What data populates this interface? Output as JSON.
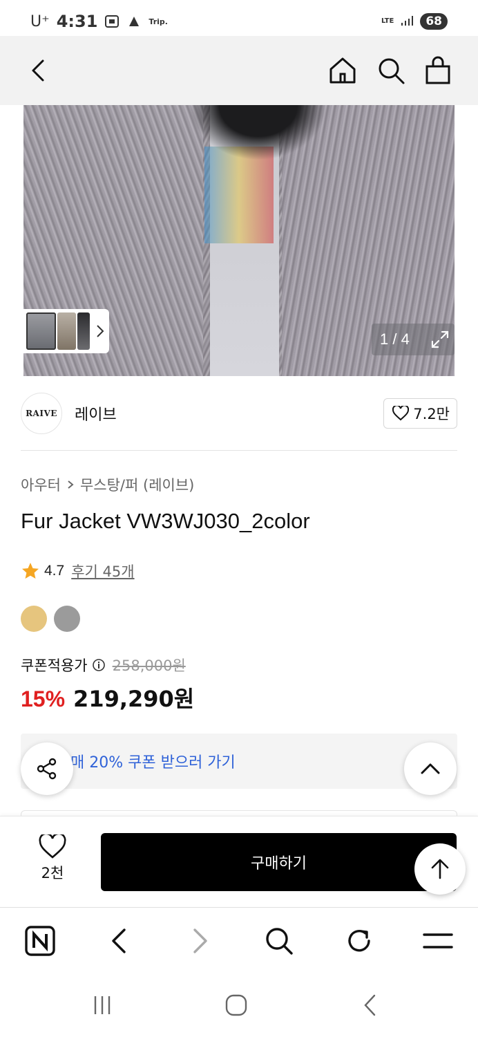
{
  "status_bar": {
    "carrier": "U⁺",
    "time": "4:31",
    "trip": "Trip.",
    "network": "LTE",
    "battery": "68"
  },
  "header": {
    "icons": [
      "back-icon",
      "home-icon",
      "search-icon",
      "shopping-bag-icon"
    ]
  },
  "gallery": {
    "current": "1",
    "total": "4",
    "counter_text": "1 / 4"
  },
  "brand": {
    "logo_text": "RAIVE",
    "name": "레이브",
    "like_count": "7.2만"
  },
  "product": {
    "category": "아우터",
    "subcategory": "무스탕/퍼 (레이브)",
    "title": "Fur Jacket VW3WJ030_2color",
    "rating": "4.7",
    "review_text": "후기 45개",
    "colors": [
      "#e6c57e",
      "#9b9b9b"
    ],
    "coupon_label": "쿠폰적용가",
    "original_price": "258,000원",
    "discount": "15%",
    "sale_price": "219,290원",
    "coupon_banner": "매 20% 쿠폰 받으러 가기"
  },
  "purchase": {
    "wish_count": "2천",
    "buy_label": "구매하기"
  },
  "colors": {
    "discount_red": "#e02020",
    "link_blue": "#2f62d8",
    "star": "#f5a623"
  }
}
